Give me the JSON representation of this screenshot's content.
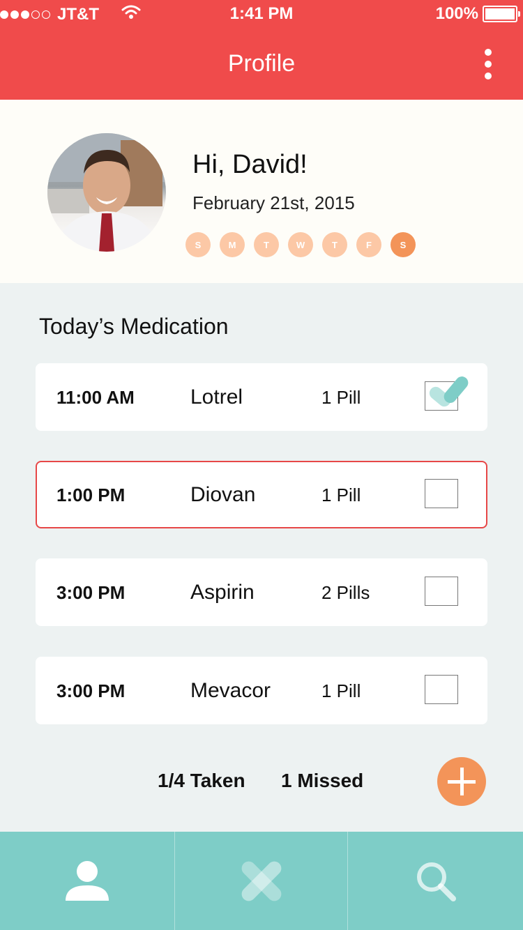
{
  "status_bar": {
    "carrier": "JT&T",
    "time": "1:41 PM",
    "battery": "100%",
    "signal_bars_filled": 3,
    "signal_bars_total": 5
  },
  "header": {
    "title": "Profile",
    "menu_icon": "more-vertical-icon"
  },
  "profile": {
    "greeting": "Hi, David!",
    "date": "February 21st, 2015",
    "days": [
      {
        "label": "S",
        "active": false
      },
      {
        "label": "M",
        "active": false
      },
      {
        "label": "T",
        "active": false
      },
      {
        "label": "W",
        "active": false
      },
      {
        "label": "T",
        "active": false
      },
      {
        "label": "F",
        "active": false
      },
      {
        "label": "S",
        "active": true
      }
    ]
  },
  "medication": {
    "title": "Today’s Medication",
    "items": [
      {
        "time": "11:00 AM",
        "name": "Lotrel",
        "dose": "1 Pill",
        "taken": true
      },
      {
        "time": "1:00 PM",
        "name": "Diovan",
        "dose": "1 Pill",
        "taken": false,
        "missed": true
      },
      {
        "time": "3:00 PM",
        "name": "Aspirin",
        "dose": "2 Pills",
        "taken": false
      },
      {
        "time": "3:00 PM",
        "name": "Mevacor",
        "dose": "1 Pill",
        "taken": false
      }
    ]
  },
  "summary": {
    "taken": "1/4 Taken",
    "missed": "1 Missed"
  },
  "colors": {
    "header": "#F04B4B",
    "accent_orange": "#F39459",
    "day_inactive": "#FCC8A6",
    "nav": "#7ECDC7",
    "alert_border": "#E74747"
  },
  "nav": {
    "tabs": [
      "person-icon",
      "pill-icon",
      "search-icon"
    ]
  }
}
